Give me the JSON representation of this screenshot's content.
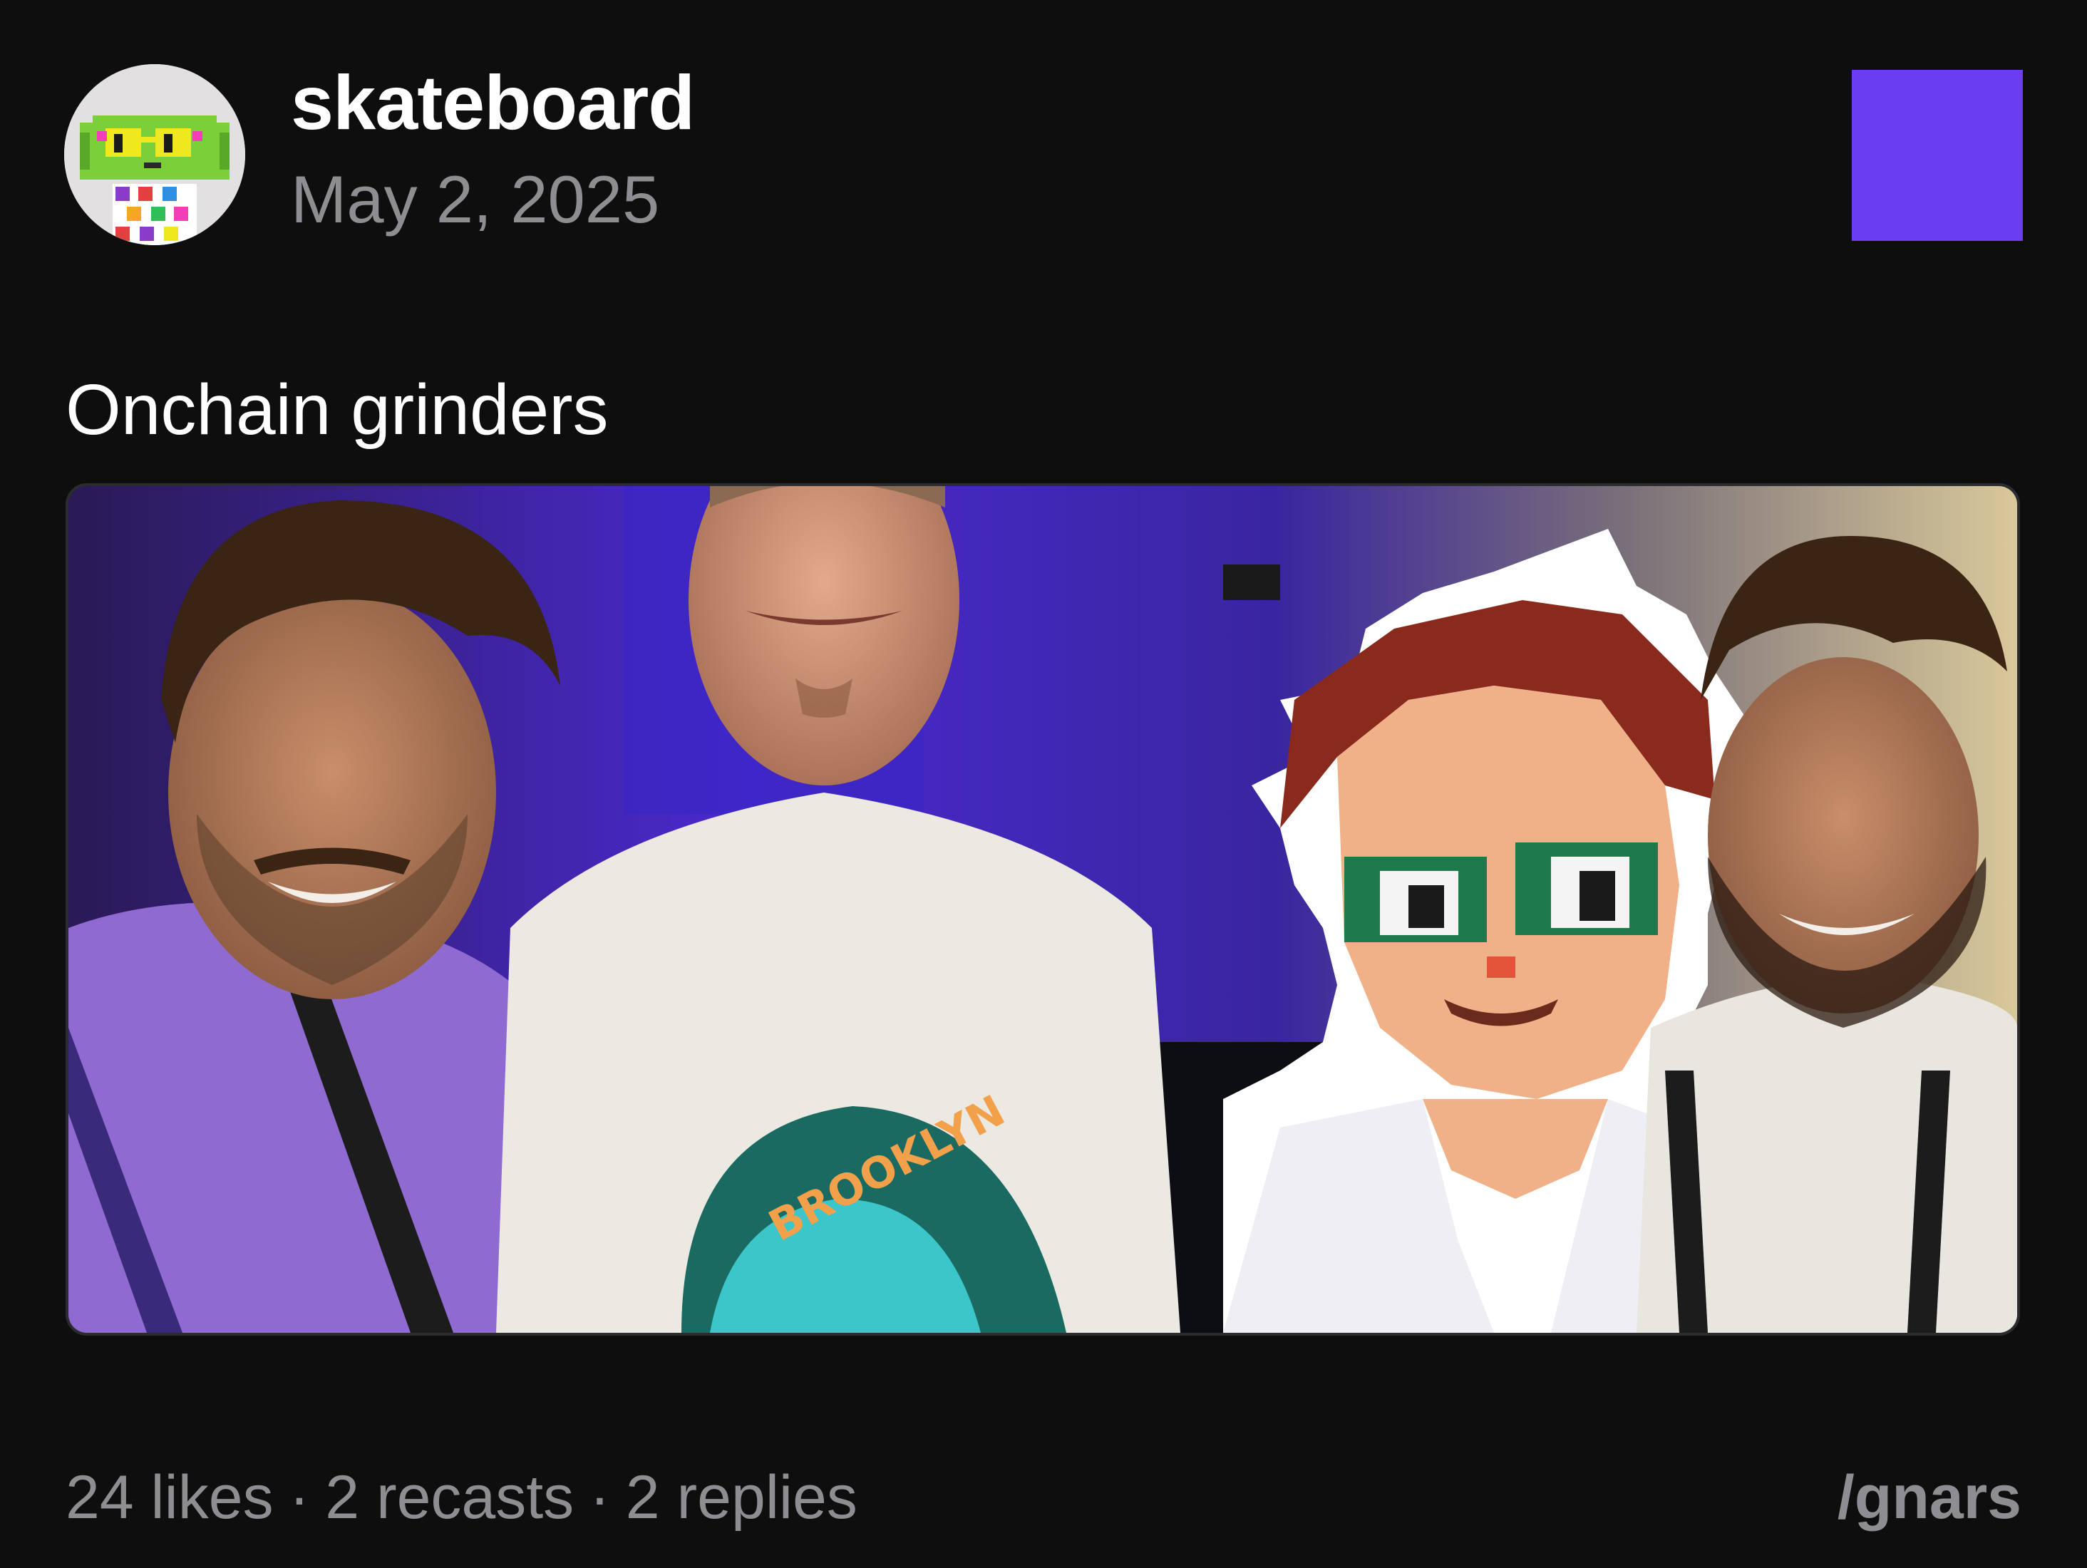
{
  "post": {
    "author": {
      "username": "skateboard",
      "avatar_icon": "pixel-character-avatar-icon"
    },
    "date": "May 2, 2025",
    "channel_badge_color": "#6a3df2",
    "text": "Onchain grinders",
    "image": {
      "description_icon": "group-photo-with-pixel-art-cutout",
      "skateboard_sticker_text": "BROOKLYN"
    },
    "stats": {
      "likes": "24 likes",
      "recasts": "2 recasts",
      "replies": "2 replies",
      "separator": "·"
    },
    "channel": "/gnars"
  }
}
